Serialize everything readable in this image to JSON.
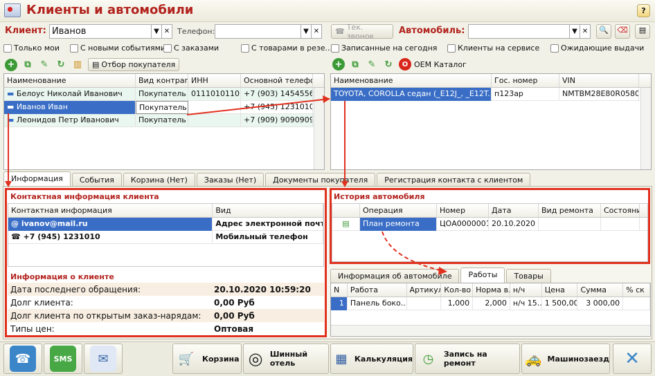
{
  "window": {
    "title": "Клиенты и автомобили",
    "help": "?"
  },
  "filters": {
    "client_label": "Клиент:",
    "client_value": "Иванов",
    "phone_label": "Телефон:",
    "phone_value": "",
    "call_btn": "Тек. звонок",
    "car_label": "Автомобиль:",
    "car_value": "",
    "checks_left": [
      "Только мои",
      "С новыми событиями",
      "С заказами",
      "С товарами в резе..."
    ],
    "checks_right": [
      "Записанные на сегодня",
      "Клиенты на сервисе",
      "Ожидающие выдачи"
    ]
  },
  "left_toolbar": {
    "buyer_filter": "Отбор покупателя"
  },
  "right_toolbar": {
    "oem": "OEM Каталог"
  },
  "clients": {
    "columns": [
      "Наименование",
      "Вид контраге...",
      "ИНН",
      "Основной телефон"
    ],
    "rows": [
      [
        "Белоус Николай Иванович",
        "Покупатель",
        "0111010110...",
        "+7 (903) 1454556"
      ],
      [
        "Иванов Иван",
        "Покупатель",
        "",
        "+7 (945) 1231010"
      ],
      [
        "Леонидов Петр Иванович",
        "Покупатель",
        "",
        "+7 (909) 9090909"
      ]
    ]
  },
  "cars": {
    "columns": [
      "Наименование",
      "Гос. номер",
      "VIN"
    ],
    "rows": [
      [
        "TOYOTA, COROLLA седан (_E12J_, _E12T...",
        "п123ар",
        "NMTBM28E80R0580..."
      ]
    ]
  },
  "tabs": [
    "Информация",
    "События",
    "Корзина (Нет)",
    "Заказы (Нет)",
    "Документы покупателя",
    "Регистрация контакта с клиентом"
  ],
  "contact": {
    "title": "Контактная информация клиента",
    "columns": [
      "Контактная информация",
      "Вид"
    ],
    "rows": [
      [
        "ivanov@mail.ru",
        "Адрес электронной почт..."
      ],
      [
        "+7 (945) 1231010",
        "Мобильный телефон"
      ]
    ]
  },
  "client_info": {
    "title": "Информация о клиенте",
    "rows": [
      [
        "Дата последнего обращения:",
        "20.10.2020 10:59:20"
      ],
      [
        "Долг клиента:",
        "0,00 Руб"
      ],
      [
        "Долг клиента по открытым заказ-нарядам:",
        "0,00 Руб"
      ],
      [
        "Типы цен:",
        "Оптовая"
      ]
    ]
  },
  "car_history": {
    "title": "История автомобиля",
    "columns": [
      "Операция",
      "Номер",
      "Дата",
      "Вид ремонта",
      "Состояние"
    ],
    "rows": [
      [
        "План ремонта",
        "ЦОА0000001",
        "20.10.2020",
        "",
        ""
      ]
    ]
  },
  "sub_tabs": [
    "Информация об автомобиле",
    "Работы",
    "Товары"
  ],
  "works": {
    "columns": [
      "N",
      "Работа",
      "Артикул",
      "Кол-во",
      "Норма в...",
      "н/ч",
      "Цена",
      "Сумма",
      "% ск"
    ],
    "rows": [
      [
        "1",
        "Панель боко...",
        "",
        "1,000",
        "2,000",
        "н/ч 15...",
        "1 500,00",
        "3 000,00",
        ""
      ]
    ]
  },
  "bottom_buttons": [
    "Корзина",
    "Шинный отель",
    "Калькуляция",
    "Запись на ремонт",
    "Машинозаезд"
  ],
  "colors": {
    "accent_red": "#b2231e",
    "selection": "#3a6ec6",
    "highlight": "#e0301e"
  }
}
